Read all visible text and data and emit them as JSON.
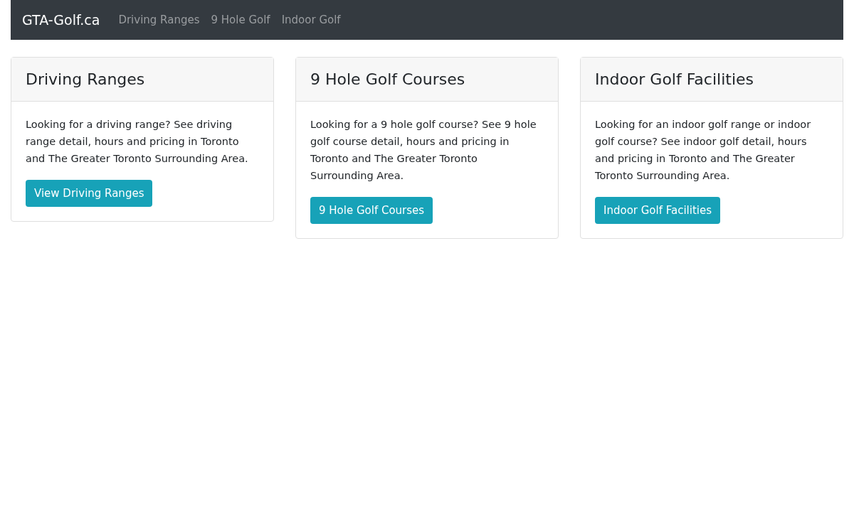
{
  "navbar": {
    "brand": "GTA-Golf.ca",
    "links": [
      {
        "label": "Driving Ranges"
      },
      {
        "label": "9 Hole Golf"
      },
      {
        "label": "Indoor Golf"
      }
    ]
  },
  "cards": [
    {
      "title": "Driving Ranges",
      "text": "Looking for a driving range? See driving range detail, hours and pricing in Toronto and The Greater Toronto Surrounding Area.",
      "button": "View Driving Ranges"
    },
    {
      "title": "9 Hole Golf Courses",
      "text": "Looking for a 9 hole golf course? See 9 hole golf course detail, hours and pricing in Toronto and The Greater Toronto Surrounding Area.",
      "button": "9 Hole Golf Courses"
    },
    {
      "title": "Indoor Golf Facilities",
      "text": "Looking for an indoor golf range or indoor golf course? See indoor golf detail, hours and pricing in Toronto and The Greater Toronto Surrounding Area.",
      "button": "Indoor Golf Facilities"
    }
  ]
}
